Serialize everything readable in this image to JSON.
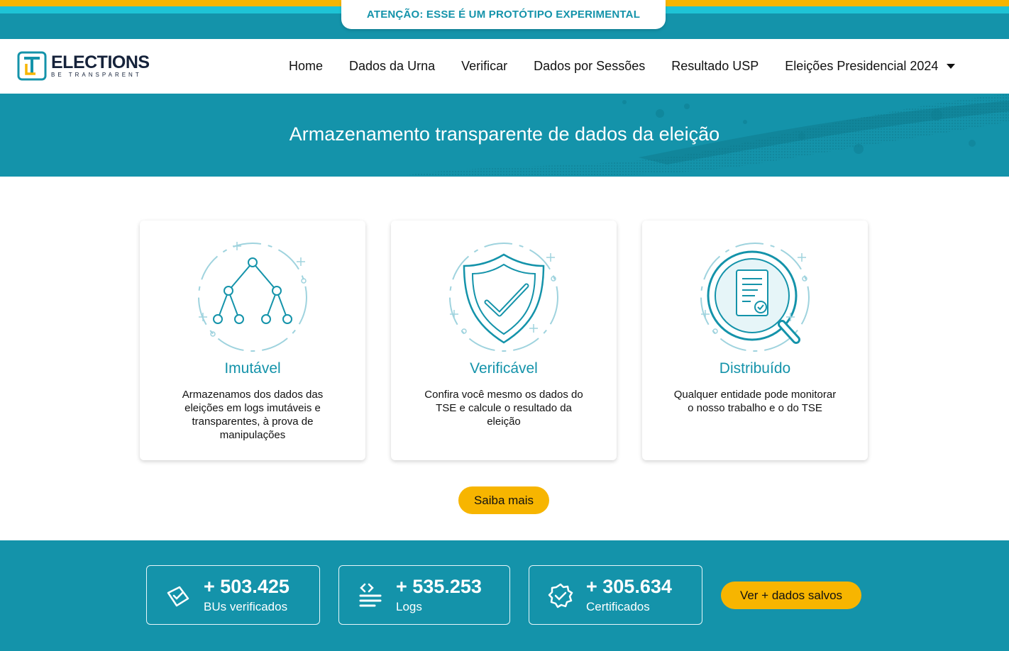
{
  "alert": {
    "text": "ATENÇÃO: ESSE É UM PROTÓTIPO EXPERIMENTAL"
  },
  "brand": {
    "title": "ELECTIONS",
    "subtitle": "BE TRANSPARENT"
  },
  "nav": {
    "items": [
      {
        "label": "Home"
      },
      {
        "label": "Dados da Urna"
      },
      {
        "label": "Verificar"
      },
      {
        "label": "Dados por Sessões"
      },
      {
        "label": "Resultado USP"
      },
      {
        "label": "Eleições Presidencial 2024"
      }
    ]
  },
  "hero": {
    "title": "Armazenamento transparente de dados da eleição"
  },
  "features": [
    {
      "icon": "tree-network-icon",
      "title": "Imutável",
      "description": "Armazenamos dos dados das eleições em logs imutáveis e transparentes, à prova de manipulações"
    },
    {
      "icon": "shield-check-icon",
      "title": "Verificável",
      "description": "Confira você mesmo os dados do TSE e calcule o resultado da eleição"
    },
    {
      "icon": "magnifier-document-icon",
      "title": "Distribuído",
      "description": "Qualquer entidade pode monitorar o nosso trabalho e o do TSE"
    }
  ],
  "cta": {
    "saiba_mais": "Saiba mais",
    "ver_mais": "Ver + dados salvos"
  },
  "stats": [
    {
      "icon": "ballot-check-icon",
      "value": "+ 503.425",
      "label": "BUs verificados"
    },
    {
      "icon": "code-lines-icon",
      "value": "+ 535.253",
      "label": "Logs"
    },
    {
      "icon": "badge-check-icon",
      "value": "+ 305.634",
      "label": "Certificados"
    }
  ],
  "colors": {
    "primary": "#1493aa",
    "accent": "#f7b500",
    "cyan": "#1ec3d6",
    "dark": "#15223a"
  }
}
